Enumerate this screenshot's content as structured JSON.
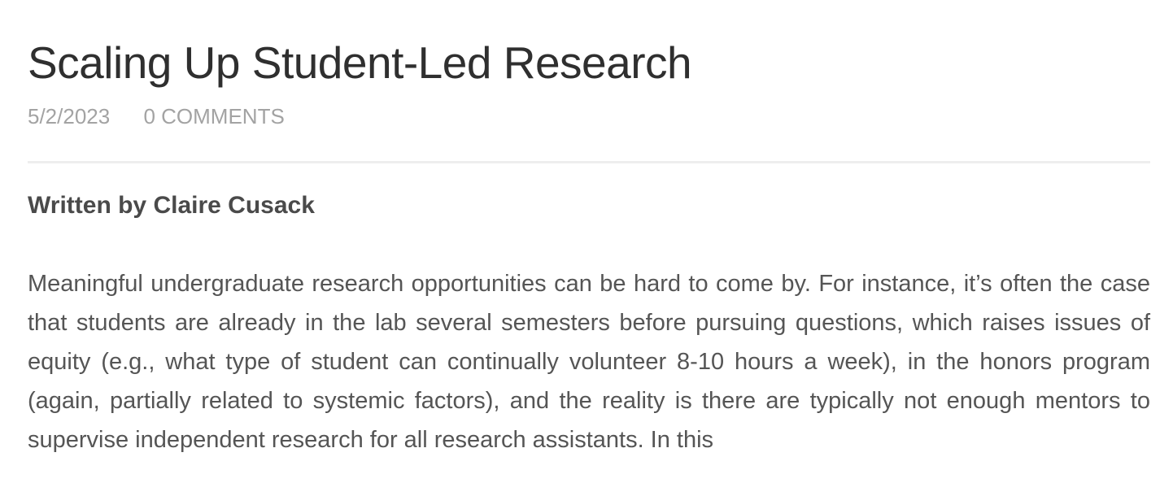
{
  "post": {
    "title": "Scaling Up Student-Led Research",
    "date": "5/2/2023",
    "comments": "0 COMMENTS",
    "author": "Written by Claire Cusack",
    "paragraph": "Meaningful undergraduate research opportunities can be hard to come by. For instance, it’s often the case that students are already in the lab several semesters before pursuing questions, which raises issues of equity (e.g., what type of student can continually volunteer 8-10 hours a week), in the honors program (again, partially related to systemic factors), and the reality is there are typically not enough mentors to supervise independent research for all research assistants. In this"
  }
}
